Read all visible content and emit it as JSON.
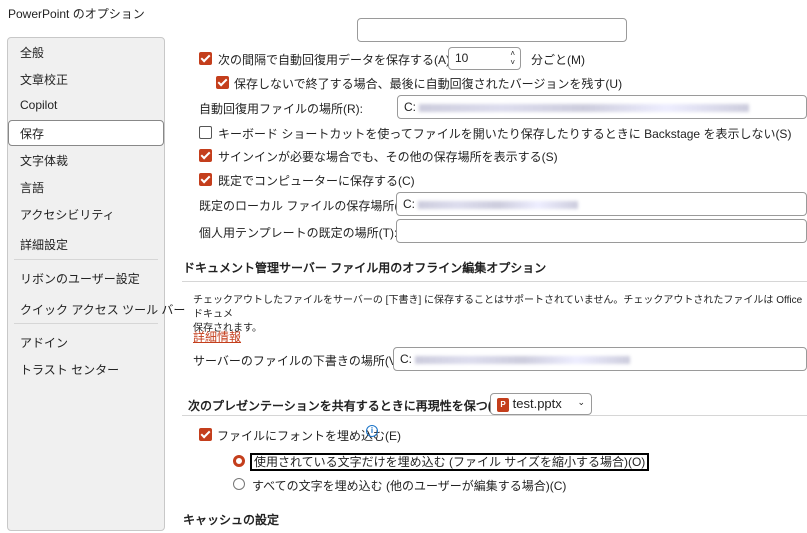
{
  "window": {
    "title": "PowerPoint のオプション"
  },
  "sidebar": {
    "items": [
      {
        "label": "全般"
      },
      {
        "label": "文章校正"
      },
      {
        "label": "Copilot"
      },
      {
        "label": "保存",
        "selected": true
      },
      {
        "label": "文字体裁"
      },
      {
        "label": "言語"
      },
      {
        "label": "アクセシビリティ"
      },
      {
        "label": "詳細設定"
      },
      {
        "label": "リボンのユーザー設定"
      },
      {
        "label": "クイック アクセス ツール バー"
      },
      {
        "label": "アドイン"
      },
      {
        "label": "トラスト センター"
      }
    ]
  },
  "save": {
    "autorecover_label": "次の間隔で自動回復用データを保存する(A):",
    "autorecover_minutes": "10",
    "minutes_suffix": "分ごと(M)",
    "keep_last_label": "保存しないで終了する場合、最後に自動回復されたバージョンを残す(U)",
    "autorecover_location_label": "自動回復用ファイルの場所(R):",
    "autorecover_location_value": "C:",
    "backstage_label": "キーボード ショートカットを使ってファイルを開いたり保存したりするときに Backstage を表示しない(S)",
    "signin_label": "サインインが必要な場合でも、その他の保存場所を表示する(S)",
    "default_computer_label": "既定でコンピューターに保存する(C)",
    "local_location_label": "既定のローカル ファイルの保存場所(I):",
    "local_location_value": "C:",
    "template_location_label": "個人用テンプレートの既定の場所(T):",
    "template_location_value": ""
  },
  "offline": {
    "header": "ドキュメント管理サーバー ファイル用のオフライン編集オプション",
    "desc_line1": "チェックアウトしたファイルをサーバーの [下書き] に保存することはサポートされていません。チェックアウトされたファイルは Office ドキュメ",
    "desc_line2": "保存されます。",
    "more_info": "詳細情報",
    "server_drafts_label": "サーバーのファイルの下書きの場所(V):",
    "server_drafts_value": "C:"
  },
  "fidelity": {
    "header": "次のプレゼンテーションを共有するときに再現性を保つ(D):",
    "file": "test.pptx",
    "embed_fonts_label": "ファイルにフォントを埋め込む(E)",
    "embed_used_label": "使用されている文字だけを埋め込む (ファイル サイズを縮小する場合)(O)",
    "embed_all_label": "すべての文字を埋め込む (他のユーザーが編集する場合)(C)"
  },
  "cache": {
    "header": "キャッシュの設定"
  },
  "colors": {
    "accent": "#c43e1c"
  }
}
